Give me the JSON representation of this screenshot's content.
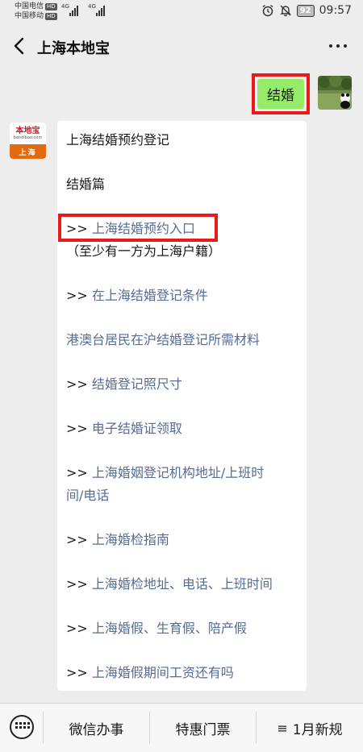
{
  "status_bar": {
    "carrier_1": "中国电信",
    "carrier_2": "中国移动",
    "hd": "HD",
    "signal_label": "4G",
    "battery": "92",
    "time": "09:57"
  },
  "header": {
    "title": "上海本地宝"
  },
  "chat": {
    "outgoing_message": "结婚",
    "bot_logo_text": "本地宝",
    "bot_logo_sub": "bendibao.com",
    "bot_logo_city": "上海",
    "reply": {
      "heading": "上海结婚预约登记",
      "section": "结婚篇",
      "prefix": ">>",
      "item_1": "上海结婚预约入口",
      "item_1_note": "（至少有一方为上海户籍）",
      "item_2": "在上海结婚登记条件",
      "item_3": "港澳台居民在沪结婚登记所需材料",
      "item_4": "结婚登记照尺寸",
      "item_5": "电子结婚证领取",
      "item_6_line1": "上海婚姻登记机构地址/上班时",
      "item_6_line2": "间/电话",
      "item_7": "上海婚检指南",
      "item_8": "上海婚检地址、电话、上班时间",
      "item_9": "上海婚假、生育假、陪产假",
      "item_10": "上海婚假期间工资还有吗"
    }
  },
  "bottom_menu": {
    "item_1": "微信办事",
    "item_2": "特惠门票",
    "item_3": "1月新规",
    "item_3_icon": "≡"
  },
  "colors": {
    "link": "#576b95",
    "outgoing_bubble": "#95ec69",
    "highlight_border": "#e81a1a",
    "background": "#ededed"
  }
}
